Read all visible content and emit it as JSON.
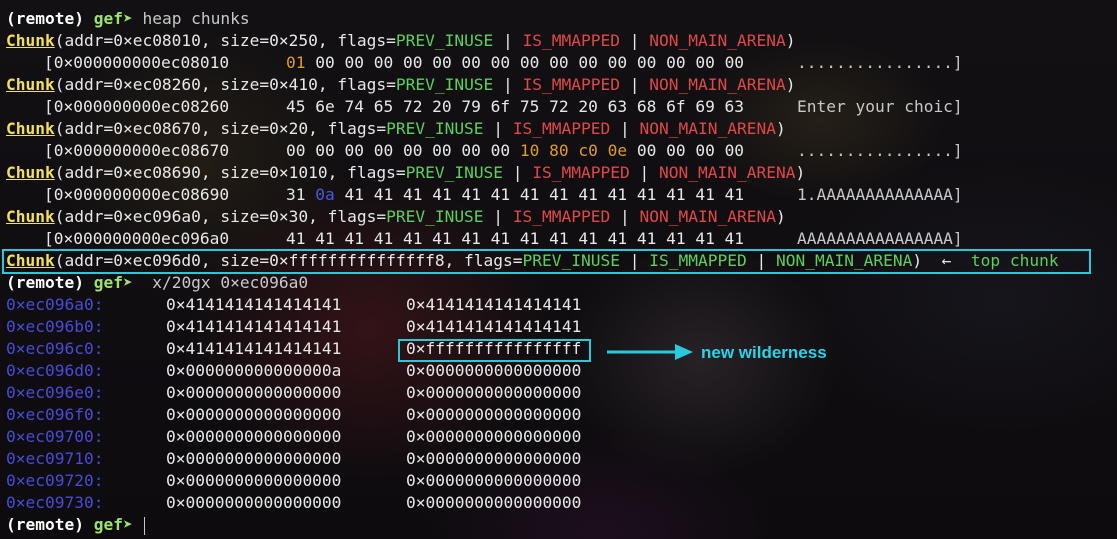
{
  "prompt": {
    "remote": "(remote)",
    "gef": "gef➤"
  },
  "cmd1": "heap chunks",
  "chunks": [
    {
      "addr_text": "(addr=0×ec08010, size=0×250, flags=",
      "dump_addr": "[0×000000000ec08010",
      "bytes_hl": "01",
      "bytes_rest": " 00 00 00 00 00 00 00 00 00 00 00 00 00 00 00",
      "ascii": "................]"
    },
    {
      "addr_text": "(addr=0×ec08260, size=0×410, flags=",
      "dump_addr": "[0×000000000ec08260",
      "bytes": "45 6e 74 65 72 20 79 6f 75 72 20 63 68 6f 69 63",
      "ascii": "Enter your choic]"
    },
    {
      "addr_text": "(addr=0×ec08670, size=0×20, flags=",
      "dump_addr": "[0×000000000ec08670",
      "bytes_pre": "00 00 00 00 00 00 00 00 ",
      "bytes_hl": "10 80 c0 0e",
      "bytes_post": " 00 00 00 00",
      "ascii": "................]"
    },
    {
      "addr_text": "(addr=0×ec08690, size=0×1010, flags=",
      "dump_addr": "[0×000000000ec08690",
      "bytes_pre": "31 ",
      "bytes_hl": "0a",
      "bytes_post": " 41 41 41 41 41 41 41 41 41 41 41 41 41 41",
      "ascii": "1.AAAAAAAAAAAAAA]"
    },
    {
      "addr_text": "(addr=0×ec096a0, size=0×30, flags=",
      "dump_addr": "[0×000000000ec096a0",
      "bytes": "41 41 41 41 41 41 41 41 41 41 41 41 41 41 41 41",
      "ascii": "AAAAAAAAAAAAAAAA]"
    }
  ],
  "chunk_label": "Chunk",
  "flag_prev": "PREV_INUSE",
  "flag_mmap": "IS_MMAPPED",
  "flag_nma": "NON_MAIN_ARENA",
  "sep": " | ",
  "close": ")",
  "top": {
    "addr_text": "(addr=0×ec096d0, size=0×fffffffffffffff8, flags=",
    "arrow": "  ←  ",
    "label": "top chunk"
  },
  "cmd2": "x/20gx 0×ec096a0",
  "mem": [
    {
      "addr": "0×ec096a0:",
      "v1": "0×4141414141414141",
      "v2": "0×4141414141414141"
    },
    {
      "addr": "0×ec096b0:",
      "v1": "0×4141414141414141",
      "v2": "0×4141414141414141"
    },
    {
      "addr": "0×ec096c0:",
      "v1": "0×4141414141414141",
      "v2": "0×ffffffffffffffff"
    },
    {
      "addr": "0×ec096d0:",
      "v1": "0×000000000000000a",
      "v2": "0×0000000000000000"
    },
    {
      "addr": "0×ec096e0:",
      "v1": "0×0000000000000000",
      "v2": "0×0000000000000000"
    },
    {
      "addr": "0×ec096f0:",
      "v1": "0×0000000000000000",
      "v2": "0×0000000000000000"
    },
    {
      "addr": "0×ec09700:",
      "v1": "0×0000000000000000",
      "v2": "0×0000000000000000"
    },
    {
      "addr": "0×ec09710:",
      "v1": "0×0000000000000000",
      "v2": "0×0000000000000000"
    },
    {
      "addr": "0×ec09720:",
      "v1": "0×0000000000000000",
      "v2": "0×0000000000000000"
    },
    {
      "addr": "0×ec09730:",
      "v1": "0×0000000000000000",
      "v2": "0×0000000000000000"
    }
  ],
  "annotation": "new wilderness",
  "colors": {
    "highlight": "#27c9dc",
    "chunk": "#f0e05a",
    "green": "#5dcf5d",
    "red": "#e04848",
    "addr": "#4a4ad8"
  }
}
